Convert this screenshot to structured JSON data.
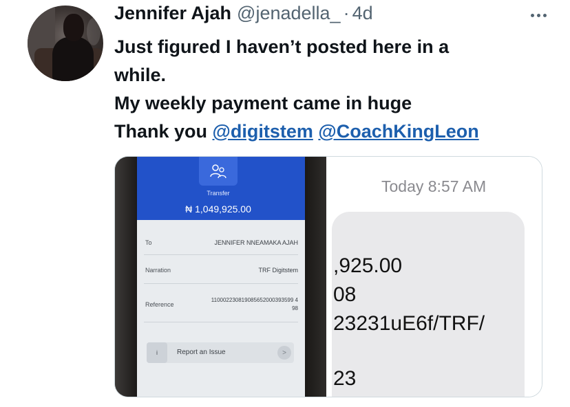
{
  "tweet": {
    "author_name": "Jennifer Ajah",
    "handle": "@jenadella_",
    "separator": "·",
    "time": "4d",
    "text_line1": "Just figured I haven’t posted here in a",
    "text_line2": "while.",
    "text_line3": "My weekly payment came in huge",
    "text_line4_prefix": "Thank you ",
    "mention1": "@digitstem",
    "mention2": "@CoachKingLeon"
  },
  "receipt": {
    "title": "Transfer",
    "amount": "₦ 1,049,925.00",
    "to_label": "To",
    "to_value": "JENNIFER NNEAMAKA AJAH",
    "narration_label": "Narration",
    "narration_value": "TRF Digitstem",
    "reference_label": "Reference",
    "reference_value_line1": "110002230819085652000393599 4",
    "reference_value_line2": "98",
    "report_label": "Report an Issue",
    "report_chevron": ">"
  },
  "sms": {
    "time": "Today 8:57 AM",
    "line1": ",925.00",
    "line2": "08",
    "line3": "23231uE6f/TRF/",
    "line4": "23"
  },
  "icons": {
    "more": "more-horizontal-icon",
    "transfer": "transfer-users-icon"
  },
  "colors": {
    "mention": "#1d5fad",
    "secondary_text": "#536471",
    "receipt_blue": "#2252c9"
  }
}
